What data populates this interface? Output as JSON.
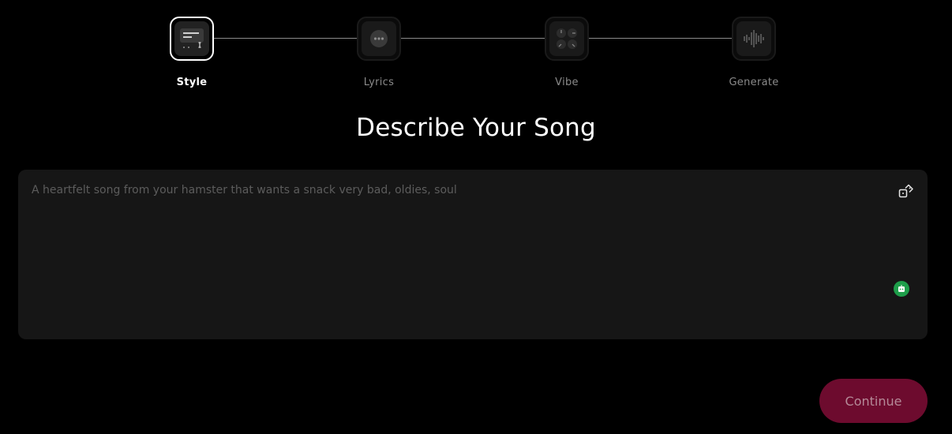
{
  "stepper": {
    "steps": [
      {
        "label": "Style",
        "icon": "style-icon",
        "active": true
      },
      {
        "label": "Lyrics",
        "icon": "chat-bubble-icon",
        "active": false
      },
      {
        "label": "Vibe",
        "icon": "knobs-icon",
        "active": false
      },
      {
        "label": "Generate",
        "icon": "waveform-icon",
        "active": false
      }
    ]
  },
  "main": {
    "title": "Describe Your Song",
    "prompt": {
      "value": "",
      "placeholder": "A heartfelt song from your hamster that wants a snack very bad, oldies, soul"
    },
    "randomize_icon": "dice-icon",
    "extension_icon": "robot-icon"
  },
  "footer": {
    "continue_label": "Continue"
  },
  "colors": {
    "background": "#000000",
    "panel": "#161616",
    "continue_bg": "#6d0b2e",
    "extension_badge": "#1e9e4a"
  }
}
